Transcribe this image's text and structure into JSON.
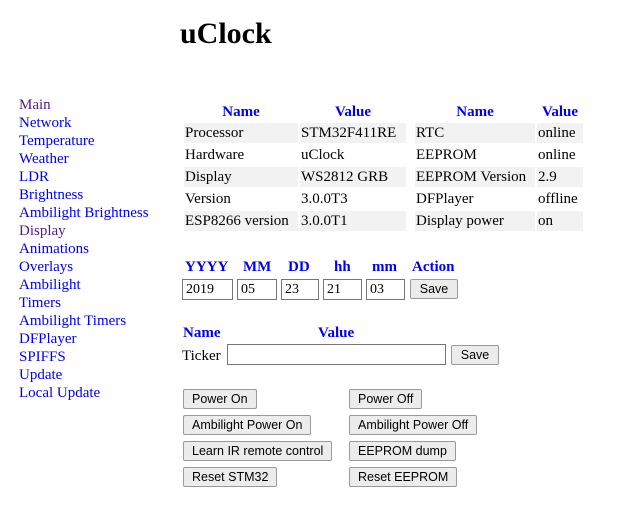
{
  "title": "uClock",
  "nav": [
    "Main",
    "Network",
    "Temperature",
    "Weather",
    "LDR",
    "Brightness",
    "Ambilight Brightness",
    "Display",
    "Animations",
    "Overlays",
    "Ambilight",
    "Timers",
    "Ambilight Timers",
    "DFPlayer",
    "SPIFFS",
    "Update",
    "Local Update"
  ],
  "info_left": {
    "headers": [
      "Name",
      "Value"
    ],
    "rows": [
      [
        "Processor",
        "STM32F411RE"
      ],
      [
        "Hardware",
        "uClock"
      ],
      [
        "Display",
        "WS2812 GRB"
      ],
      [
        "Version",
        "3.0.0T3"
      ],
      [
        "ESP8266 version",
        "3.0.0T1"
      ]
    ]
  },
  "info_right": {
    "headers": [
      "Name",
      "Value"
    ],
    "rows": [
      [
        "RTC",
        "online"
      ],
      [
        "EEPROM",
        "online"
      ],
      [
        "EEPROM Version",
        "2.9"
      ],
      [
        "DFPlayer",
        "offline"
      ],
      [
        "Display power",
        "on"
      ]
    ]
  },
  "datetime": {
    "headers": [
      "YYYY",
      "MM",
      "DD",
      "hh",
      "mm",
      "Action"
    ],
    "values": [
      "2019",
      "05",
      "23",
      "21",
      "03"
    ],
    "save_label": "Save"
  },
  "ticker": {
    "headers": [
      "Name",
      "Value"
    ],
    "label": "Ticker",
    "value": "",
    "save_label": "Save"
  },
  "actions": {
    "power_on": "Power On",
    "power_off": "Power Off",
    "ambilight_on": "Ambilight Power On",
    "ambilight_off": "Ambilight Power Off",
    "learn_ir": "Learn IR remote control",
    "eeprom_dump": "EEPROM dump",
    "reset_stm32": "Reset STM32",
    "reset_eeprom": "Reset EEPROM"
  }
}
